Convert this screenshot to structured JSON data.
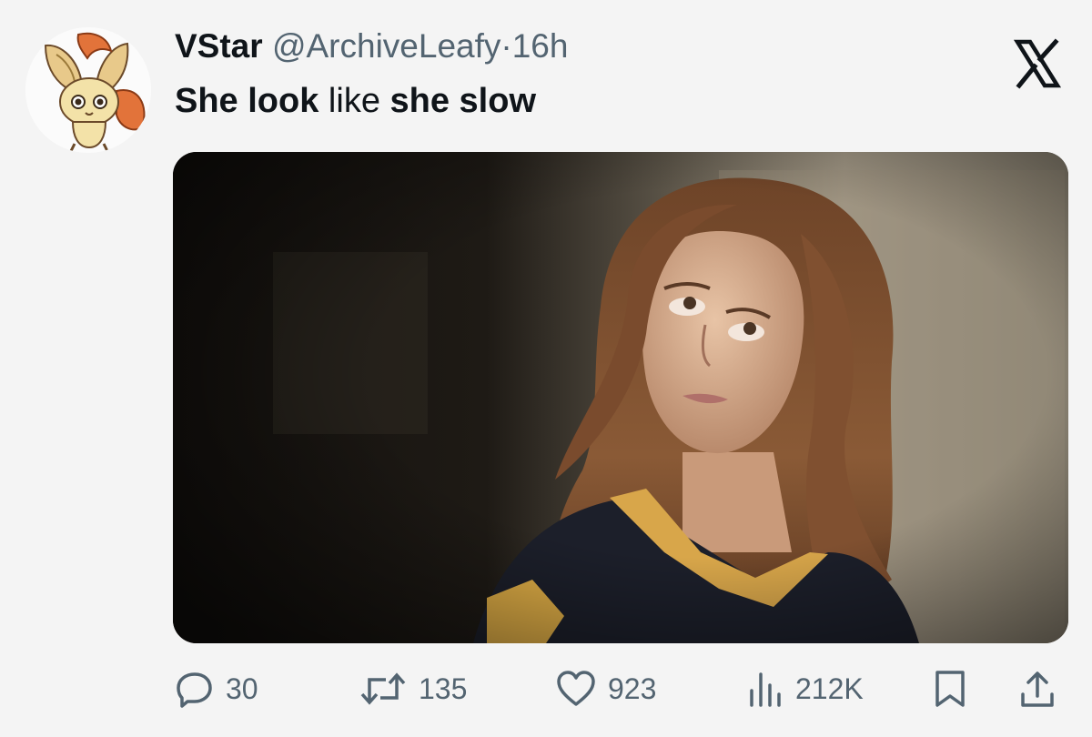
{
  "tweet": {
    "author_name": "VStar",
    "handle": "@ArchiveLeafy",
    "separator": "·",
    "time": "16h",
    "text": {
      "part1": "She look",
      "part2": " like ",
      "part3": "she slow"
    }
  },
  "avatar": {
    "icon": "leafeon-avatar-icon"
  },
  "brand": {
    "icon": "x-logo-icon"
  },
  "media": {
    "icon": "photo-woman-looking-up"
  },
  "actions": {
    "replies": "30",
    "reposts": "135",
    "likes": "923",
    "views": "212K"
  },
  "colors": {
    "text": "#0f1419",
    "secondary": "#536471",
    "background": "#f4f4f4"
  }
}
